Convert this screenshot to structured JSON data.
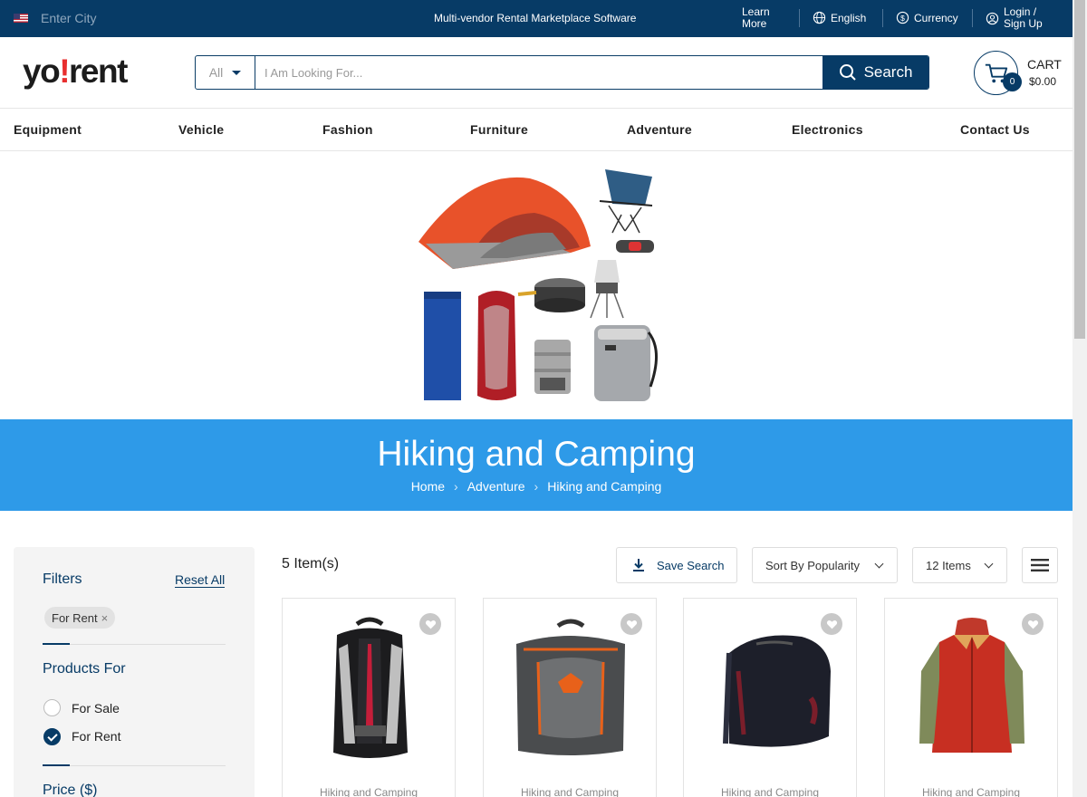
{
  "topbar": {
    "city_placeholder": "Enter City",
    "tagline": "Multi-vendor Rental Marketplace Software",
    "learn_line1": "Learn",
    "learn_line2": "More",
    "language": "English",
    "currency": "Currency",
    "login_line1": "Login /",
    "login_line2": "Sign Up"
  },
  "header": {
    "logo_part1": "yo",
    "logo_part2": "!",
    "logo_part3": "rent",
    "category_select": "All",
    "search_placeholder": "I Am Looking For...",
    "search_button": "Search",
    "cart_label": "CART",
    "cart_count": "0",
    "cart_total": "$0.00"
  },
  "nav": {
    "items": [
      "Equipment",
      "Vehicle",
      "Fashion",
      "Furniture",
      "Adventure",
      "Electronics",
      "Contact Us"
    ]
  },
  "banner": {
    "title": "Hiking and Camping",
    "breadcrumbs": [
      "Home",
      "Adventure",
      "Hiking and Camping"
    ]
  },
  "filters": {
    "title": "Filters",
    "reset": "Reset All",
    "active_chip": "For Rent",
    "chip_close": "×",
    "products_for_heading": "Products For",
    "options": [
      {
        "label": "For Sale",
        "selected": false
      },
      {
        "label": "For Rent",
        "selected": true
      }
    ],
    "price_heading": "Price ($)"
  },
  "listing": {
    "count": "5 Item(s)",
    "save_search": "Save Search",
    "sort": "Sort By Popularity",
    "per_page": "12 Items"
  },
  "products": [
    {
      "category": "Hiking and Camping",
      "image": "black-red-backpack"
    },
    {
      "category": "Hiking and Camping",
      "image": "grey-orange-backpack"
    },
    {
      "category": "Hiking and Camping",
      "image": "black-duffel-bag"
    },
    {
      "category": "Hiking and Camping",
      "image": "red-green-jacket"
    }
  ],
  "colors": {
    "primary": "#073b66",
    "banner": "#2e9ae8",
    "logo_accent": "#e82e2e"
  }
}
